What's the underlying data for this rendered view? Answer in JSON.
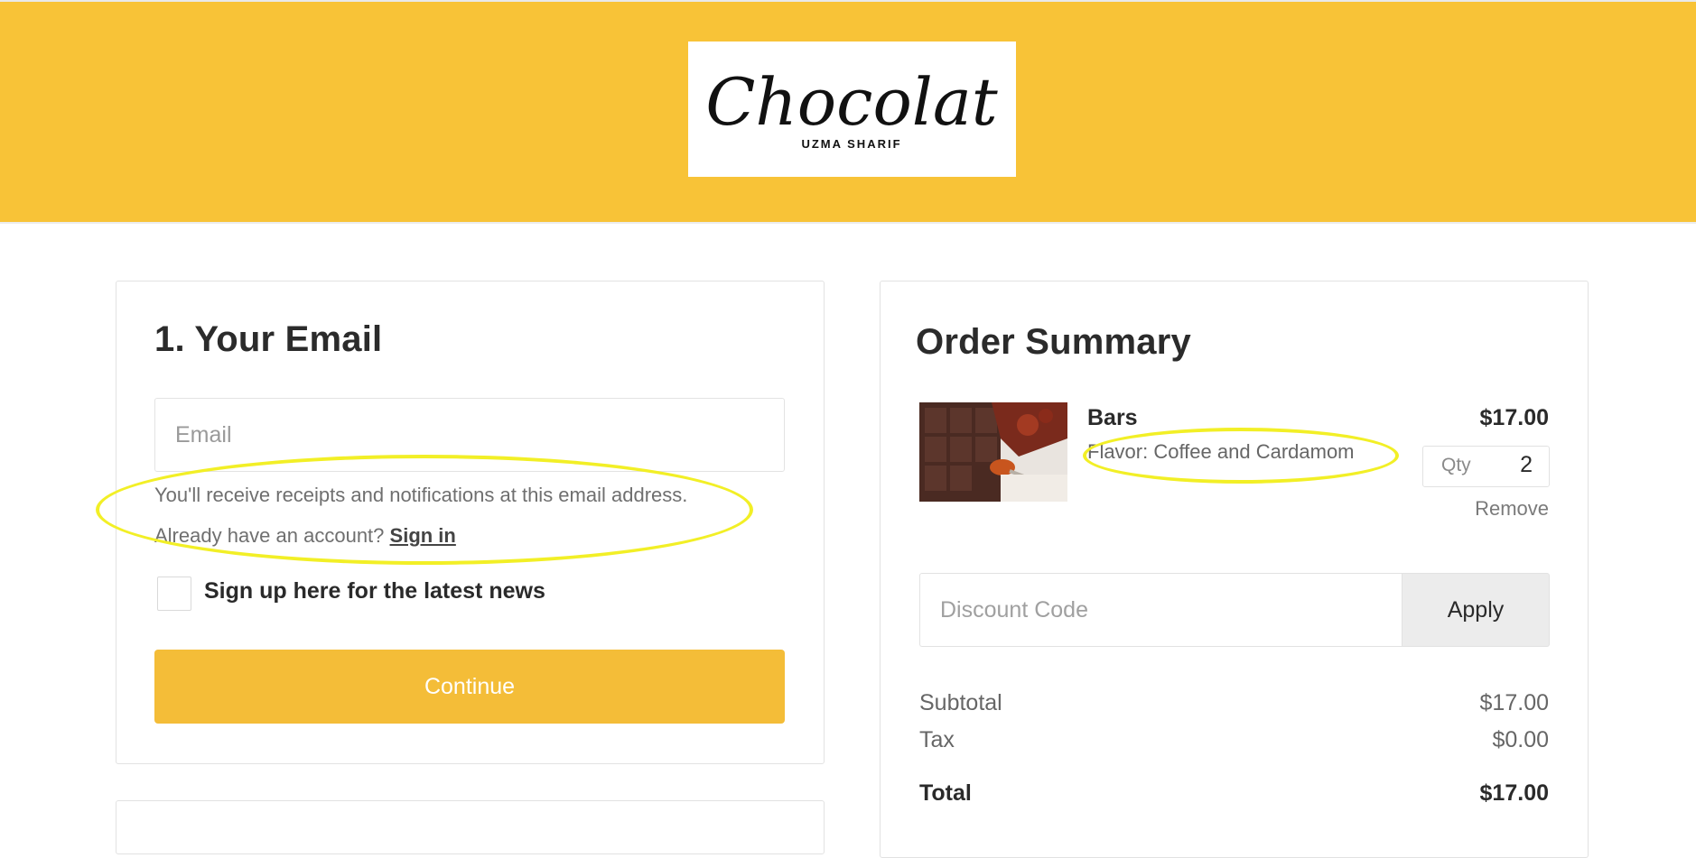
{
  "header": {
    "logo_alt": "Chocolat",
    "logo_text": "Chocolat",
    "logo_subtext": "UZMA SHARIF"
  },
  "email_section": {
    "title": "1.  Your Email",
    "email_placeholder": "Email",
    "receipt_note": "You'll receive receipts and notifications at this email address.",
    "account_prompt": "Already have an account?",
    "sign_in_label": "Sign in",
    "newsletter_label": "Sign up here for the latest news",
    "newsletter_checked": false,
    "continue_label": "Continue"
  },
  "order_summary": {
    "title": "Order Summary",
    "item": {
      "name": "Bars",
      "flavor": "Flavor: Coffee and Cardamom",
      "price": "$17.00",
      "qty_label": "Qty",
      "qty_value": "2",
      "remove_label": "Remove"
    },
    "discount_placeholder": "Discount Code",
    "apply_label": "Apply",
    "subtotal_label": "Subtotal",
    "subtotal_value": "$17.00",
    "tax_label": "Tax",
    "tax_value": "$0.00",
    "total_label": "Total",
    "total_value": "$17.00"
  },
  "colors": {
    "brand_yellow": "#f8c337",
    "button_yellow": "#f4bd38",
    "highlight_yellow": "#f2ef26"
  }
}
